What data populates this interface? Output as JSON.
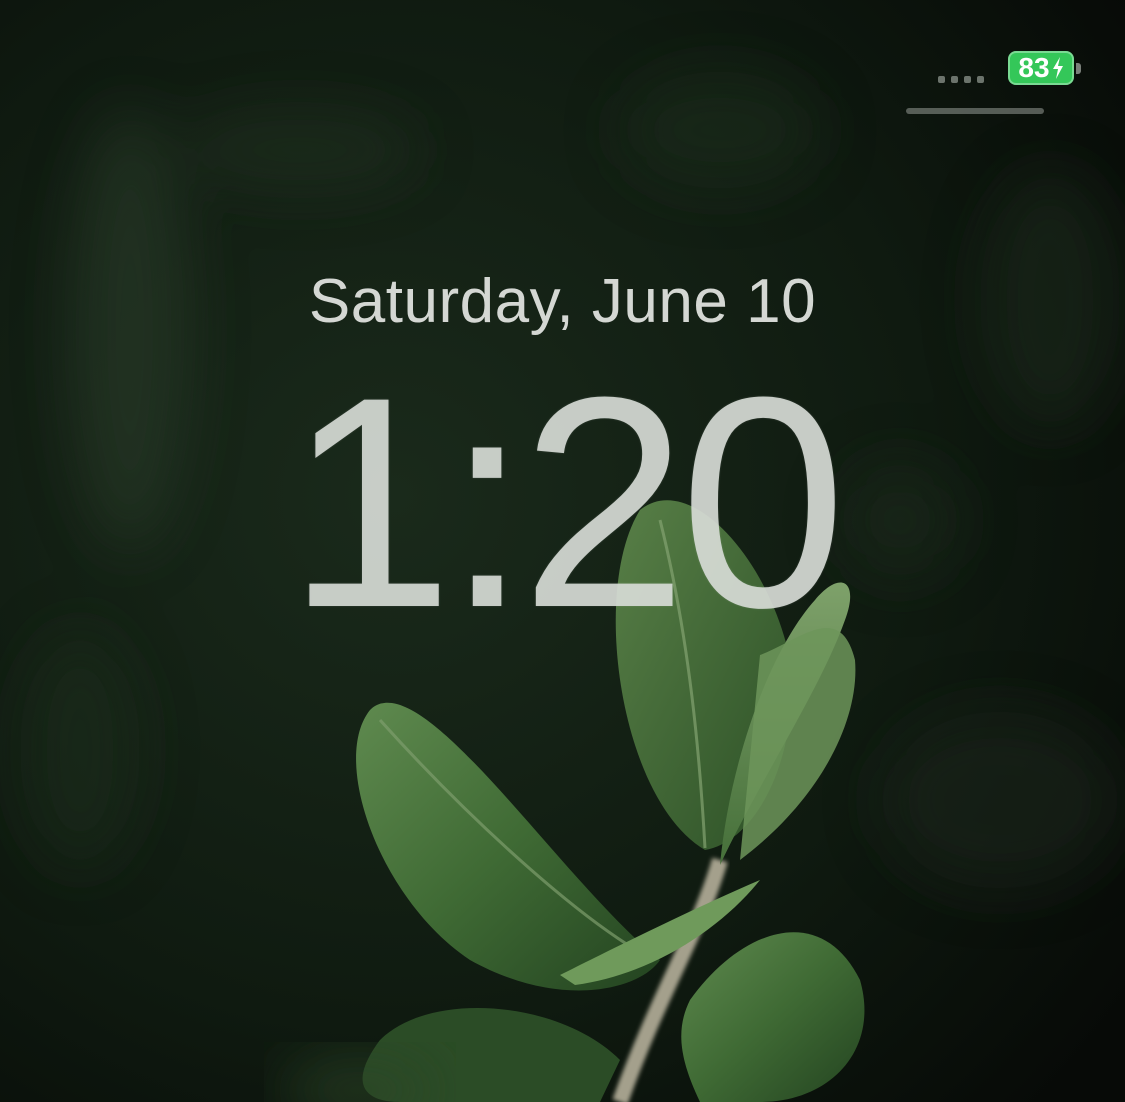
{
  "lock_screen": {
    "date": "Saturday, June 10",
    "time": "1:20"
  },
  "status_bar": {
    "signal_bars": 4,
    "battery_percent": "83",
    "battery_charging": true,
    "battery_color": "#34c759"
  },
  "wallpaper": {
    "subject": "green-leaves-plant-icon",
    "background_color": "#0b0f0b",
    "leaf_color": "#3f6a34"
  }
}
